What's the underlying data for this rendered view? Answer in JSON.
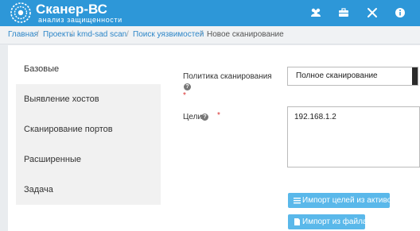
{
  "header": {
    "brand": "Сканер-ВС",
    "tagline": "анализ защищенности",
    "icons": [
      "users-icon",
      "briefcase-icon",
      "tools-icon",
      "info-icon"
    ],
    "accent_color": "#2d97d8"
  },
  "breadcrumb": {
    "items": [
      "Главная",
      "Проекты",
      "kmd-sad scan",
      "Поиск уязвимостей"
    ],
    "current": "Новое сканирование",
    "separator": "/"
  },
  "tabs": {
    "active": "Базовые",
    "items": [
      "Базовые",
      "Выявление хостов",
      "Сканирование портов",
      "Расширенные",
      "Задача"
    ]
  },
  "form": {
    "policy_label": "Политика сканирования",
    "policy_value": "Полное сканирование",
    "targets_label": "Цели",
    "targets_value": "192.168.1.2",
    "required_mark": "*",
    "help_mark": "?"
  },
  "buttons": {
    "import_assets": "Импорт целей из активов",
    "import_file": "Импорт из файла"
  }
}
